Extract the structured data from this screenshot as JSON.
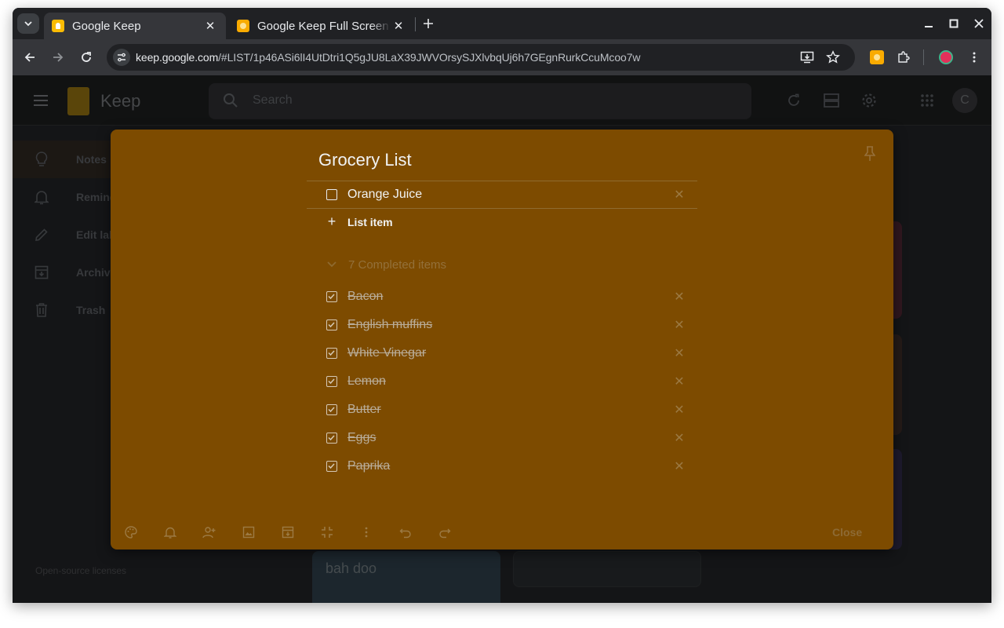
{
  "browser": {
    "tabs": [
      {
        "label": "Google Keep",
        "active": true,
        "favicon_color": "#fbbc04"
      },
      {
        "label": "Google Keep Full Screen",
        "active": false,
        "favicon_color": "#f9ab00"
      }
    ],
    "url_host": "keep.google.com",
    "url_path": "/#LIST/1p46ASi6lI4UtDtri1Q5gJU8LaX39JWVOrsySJXlvbqUj6h7GEgnRurkCcuMcoo7w"
  },
  "keep": {
    "app_title": "Keep",
    "search_placeholder": "Search",
    "avatar_initial": "C",
    "sidebar": [
      {
        "label": "Notes",
        "icon": "lightbulb-icon",
        "active": true
      },
      {
        "label": "Reminders",
        "icon": "bell-icon",
        "active": false
      },
      {
        "label": "Edit labels",
        "icon": "pencil-icon",
        "active": false
      },
      {
        "label": "Archive",
        "icon": "archive-icon",
        "active": false
      },
      {
        "label": "Trash",
        "icon": "trash-icon",
        "active": false
      }
    ],
    "open_source": "Open-source licenses",
    "background_note_text": "bah doo"
  },
  "note": {
    "title": "Grocery List",
    "color": "#7d4b00",
    "open_items": [
      {
        "text": "Orange Juice",
        "checked": false
      }
    ],
    "add_item_label": "List item",
    "completed_label": "7 Completed items",
    "completed_items": [
      {
        "text": "Bacon",
        "checked": true
      },
      {
        "text": "English muffins",
        "checked": true
      },
      {
        "text": "White Vinegar",
        "checked": true
      },
      {
        "text": "Lemon",
        "checked": true
      },
      {
        "text": "Butter",
        "checked": true
      },
      {
        "text": "Eggs",
        "checked": true
      },
      {
        "text": "Paprika",
        "checked": true
      }
    ],
    "close_label": "Close"
  }
}
